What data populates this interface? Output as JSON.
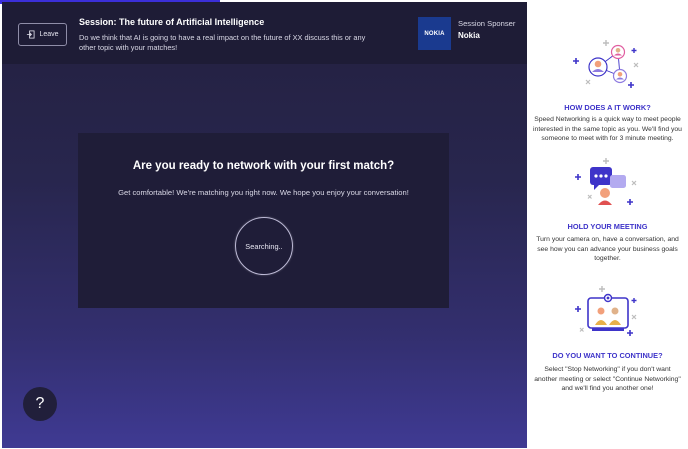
{
  "progress": {
    "fraction": 0.32
  },
  "header": {
    "leave_label": "Leave",
    "session_title": "Session: The future of Artificial Intelligence",
    "session_description": "Do we think that AI is going to have a real impact on the future of XX discuss this or any other topic with your matches!",
    "sponsor_label": "Session Sponser",
    "sponsor_name": "Nokia",
    "sponsor_logo_text": "NOKIA"
  },
  "match": {
    "heading": "Are you ready to network with your first match?",
    "subheading": "Get comfortable! We're matching you right now. We hope you enjoy your conversation!",
    "status": "Searching.."
  },
  "help": {
    "label": "?"
  },
  "sidebar": {
    "sections": [
      {
        "icon": "network-people-icon",
        "heading": "HOW DOES A IT WORK?",
        "text": "Speed Networking is a quick way to meet people interested in the same topic as you. We'll find you someone to meet with for 3 minute meeting."
      },
      {
        "icon": "video-meeting-icon",
        "heading": "HOLD YOUR MEETING",
        "text": "Turn your camera on, have a conversation, and see how you can advance your business goals together."
      },
      {
        "icon": "continue-meeting-icon",
        "heading": "DO YOU WANT TO CONTINUE?",
        "text": "Select \"Stop Networking\" if you don't want another meeting or select \"Continue Networking\" and we'll find you another one!"
      }
    ]
  },
  "colors": {
    "accent": "#3e34c9",
    "header_bg": "#1e1c36",
    "card_bg": "#1f1d38",
    "sponsor_blue": "#1a3a8f"
  }
}
